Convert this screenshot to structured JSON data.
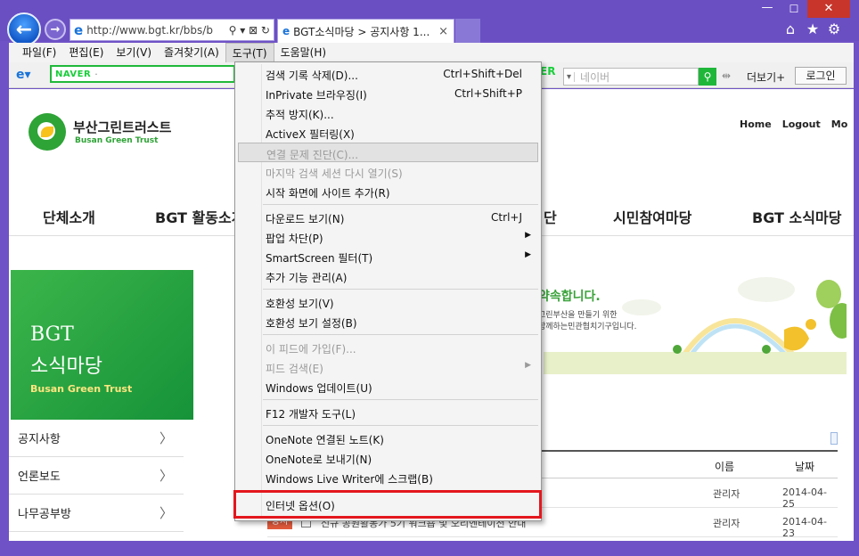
{
  "browser": {
    "url": "http://www.bgt.kr/bbs/b",
    "tab_title": "BGT소식마당 > 공지사항 1...",
    "tab_close": "×",
    "address_tools": "⚲ ▾ ⊠ ↻",
    "back_glyph": "←",
    "forward_glyph": "→"
  },
  "menubar": {
    "items": [
      "파일(F)",
      "편집(E)",
      "보기(V)",
      "즐겨찾기(A)",
      "도구(T)",
      "도움말(H)"
    ]
  },
  "toolbar": {
    "naver_logo": "NAVER",
    "naver_sep": "·",
    "naver_logo_partial": "ER",
    "search_dropdown": "▾",
    "search_placeholder": "네이버",
    "more_label": "더보기+",
    "login_label": "로그인"
  },
  "tools_menu": {
    "items": [
      {
        "label": "검색 기록 삭제(D)...",
        "shortcut": "Ctrl+Shift+Del"
      },
      {
        "label": "InPrivate 브라우징(I)",
        "shortcut": "Ctrl+Shift+P"
      },
      {
        "label": "추적 방지(K)..."
      },
      {
        "label": "ActiveX 필터링(X)"
      },
      {
        "label": "연결 문제 진단(C)..."
      },
      {
        "label": "마지막 검색 세션 다시 열기(S)"
      },
      {
        "label": "시작 화면에 사이트 추가(R)"
      },
      {
        "label": "다운로드 보기(N)",
        "shortcut": "Ctrl+J"
      },
      {
        "label": "팝업 차단(P)"
      },
      {
        "label": "SmartScreen 필터(T)"
      },
      {
        "label": "추가 기능 관리(A)"
      },
      {
        "label": "호환성 보기(V)"
      },
      {
        "label": "호환성 보기 설정(B)"
      },
      {
        "label": "이 피드에 가입(F)..."
      },
      {
        "label": "피드 검색(E)"
      },
      {
        "label": "Windows 업데이트(U)"
      },
      {
        "label": "F12 개발자 도구(L)"
      },
      {
        "label": "OneNote 연결된 노트(K)"
      },
      {
        "label": "OneNote로 보내기(N)"
      },
      {
        "label": "Windows Live Writer에 스크랩(B)"
      },
      {
        "label": "인터넷 옵션(O)"
      }
    ]
  },
  "site": {
    "logo_kr": "부산그린트러스트",
    "logo_en": "Busan Green Trust",
    "util_links": [
      "Home",
      "Logout",
      "Mo"
    ],
    "nav": [
      "단체소개",
      "BGT 활동소개",
      "단",
      "시민참여마당",
      "BGT 소식마당"
    ],
    "side_title_1": "BGT",
    "side_title_2": "소식마당",
    "side_sub": "Busan Green Trust",
    "side_menu": [
      "공지사항",
      "언론보도",
      "나무공부방"
    ],
    "side_chevron": "〉",
    "hero_title": "약속합니다.",
    "hero_sub_1": "그린부산을 만들기 위한",
    "hero_sub_2": "함께하는민관협치기구입니다.",
    "board_header_name": "이름",
    "board_header_date": "날짜",
    "rows": [
      {
        "title": ".",
        "author": "관리자",
        "date": "2014-04-25"
      },
      {
        "badge": "공지",
        "title": "신규 공원활동가 5기 워크숍 및 오리엔테이션 안내",
        "author": "관리자",
        "date": "2014-04-23"
      }
    ]
  },
  "colors": {
    "chrome": "#6a4fc3",
    "highlight_box": "#e3171d",
    "brand_green": "#2ea336"
  }
}
